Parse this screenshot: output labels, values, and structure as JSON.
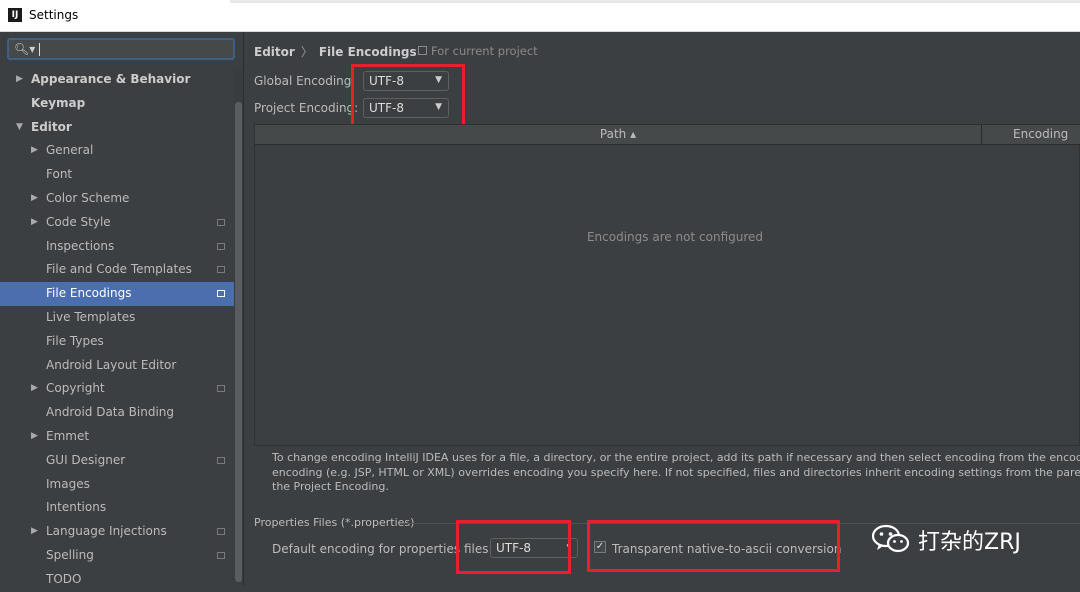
{
  "window": {
    "title": "Settings"
  },
  "search": {
    "value": ""
  },
  "tree": [
    {
      "label": "Appearance & Behavior",
      "level": 0,
      "arrow": "right",
      "bold": true
    },
    {
      "label": "Keymap",
      "level": 0,
      "arrow": "",
      "bold": true
    },
    {
      "label": "Editor",
      "level": 0,
      "arrow": "down",
      "bold": true
    },
    {
      "label": "General",
      "level": 1,
      "arrow": "right"
    },
    {
      "label": "Font",
      "level": 1,
      "arrow": ""
    },
    {
      "label": "Color Scheme",
      "level": 1,
      "arrow": "right"
    },
    {
      "label": "Code Style",
      "level": 1,
      "arrow": "right",
      "project": true
    },
    {
      "label": "Inspections",
      "level": 1,
      "arrow": "",
      "project": true
    },
    {
      "label": "File and Code Templates",
      "level": 1,
      "arrow": "",
      "project": true
    },
    {
      "label": "File Encodings",
      "level": 1,
      "arrow": "",
      "project": true,
      "selected": true
    },
    {
      "label": "Live Templates",
      "level": 1,
      "arrow": ""
    },
    {
      "label": "File Types",
      "level": 1,
      "arrow": ""
    },
    {
      "label": "Android Layout Editor",
      "level": 1,
      "arrow": ""
    },
    {
      "label": "Copyright",
      "level": 1,
      "arrow": "right",
      "project": true
    },
    {
      "label": "Android Data Binding",
      "level": 1,
      "arrow": ""
    },
    {
      "label": "Emmet",
      "level": 1,
      "arrow": "right"
    },
    {
      "label": "GUI Designer",
      "level": 1,
      "arrow": "",
      "project": true
    },
    {
      "label": "Images",
      "level": 1,
      "arrow": ""
    },
    {
      "label": "Intentions",
      "level": 1,
      "arrow": ""
    },
    {
      "label": "Language Injections",
      "level": 1,
      "arrow": "right",
      "project": true
    },
    {
      "label": "Spelling",
      "level": 1,
      "arrow": "",
      "project": true
    },
    {
      "label": "TODO",
      "level": 1,
      "arrow": ""
    }
  ],
  "breadcrumb": {
    "parent": "Editor",
    "separator": "〉",
    "current": "File Encodings"
  },
  "scope_note": "For current project",
  "global_encoding": {
    "label": "Global Encoding:",
    "value": "UTF-8"
  },
  "project_encoding": {
    "label": "Project Encoding:",
    "value": "UTF-8"
  },
  "table": {
    "col_path": "Path ▴",
    "col_encoding": "Encoding",
    "empty_text": "Encodings are not configured"
  },
  "help_lines": [
    "To change encoding IntelliJ IDEA uses for a file, a directory, or the entire project, add its path if necessary and then select encoding from the encoding list. Built-in",
    "encoding (e.g. JSP, HTML or XML) overrides encoding you specify here. If not specified, files and directories inherit encoding settings from the parent directory or t",
    "the Project Encoding."
  ],
  "properties": {
    "section": "Properties Files (*.properties)",
    "default_label": "Default encoding for properties files:",
    "default_value": "UTF-8",
    "transparent_label": "Transparent native-to-ascii conversion",
    "transparent_checked": true
  },
  "watermark": {
    "text": "打杂的ZRJ"
  },
  "colors": {
    "selection": "#4b6eaf",
    "highlight_box": "#e8202a",
    "background": "#3c3f41"
  }
}
